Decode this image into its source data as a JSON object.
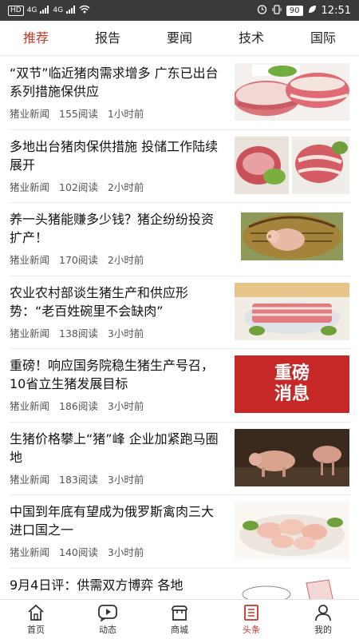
{
  "status_bar": {
    "left_chip": "HD",
    "signal_1": "4G",
    "signal_2": "4G",
    "battery": "90",
    "time": "12:51"
  },
  "tabs": [
    {
      "label": "推荐",
      "active": true
    },
    {
      "label": "报告",
      "active": false
    },
    {
      "label": "要闻",
      "active": false
    },
    {
      "label": "技术",
      "active": false
    },
    {
      "label": "国际",
      "active": false
    }
  ],
  "feed": [
    {
      "title": "“双节”临近猪肉需求增多 广东已出台系列措施保供应",
      "source": "猪业新闻",
      "reads": "155阅读",
      "time": "1小时前",
      "image": "pork-meat-photo"
    },
    {
      "title": "多地出台猪肉保供措施 投储工作陆续展开",
      "source": "猪业新闻",
      "reads": "102阅读",
      "time": "2小时前",
      "image": "pork-cuts-photo"
    },
    {
      "title": "养一头猪能赚多少钱？猪企纷纷投资扩产！",
      "source": "猪业新闻",
      "reads": "170阅读",
      "time": "2小时前",
      "image": "pig-in-pen-photo"
    },
    {
      "title": "农业农村部谈生猪生产和供应形势：“老百姓碗里不会缺肉”",
      "source": "猪业新闻",
      "reads": "138阅读",
      "time": "3小时前",
      "image": "pork-slab-photo"
    },
    {
      "title": "重磅！响应国务院稳生猪生产号召，10省立生猪发展目标",
      "source": "猪业新闻",
      "reads": "186阅读",
      "time": "3小时前",
      "image": "breaking-news-banner",
      "image_text": "重磅\n消息"
    },
    {
      "title": "生猪价格攀上“猪”峰 企业加紧跑马圈地",
      "source": "猪业新闻",
      "reads": "183阅读",
      "time": "3小时前",
      "image": "pigs-farm-photo"
    },
    {
      "title": "中国到年底有望成为俄罗斯禽肉三大进口国之一",
      "source": "猪业新闻",
      "reads": "140阅读",
      "time": "3小时前",
      "image": "chicken-meat-photo"
    },
    {
      "title": "9月4日评：供需双方博弈 各地",
      "source": "",
      "reads": "",
      "time": "",
      "image": "cartoon-photo"
    }
  ],
  "bottom_nav": [
    {
      "label": "首页",
      "icon": "home-icon",
      "active": false
    },
    {
      "label": "动态",
      "icon": "play-bubble-icon",
      "active": false
    },
    {
      "label": "商城",
      "icon": "store-icon",
      "active": false
    },
    {
      "label": "头条",
      "icon": "headline-icon",
      "active": true
    },
    {
      "label": "我的",
      "icon": "person-icon",
      "active": false
    }
  ],
  "colors": {
    "accent": "#c0392b",
    "banner_red": "#c62828"
  }
}
